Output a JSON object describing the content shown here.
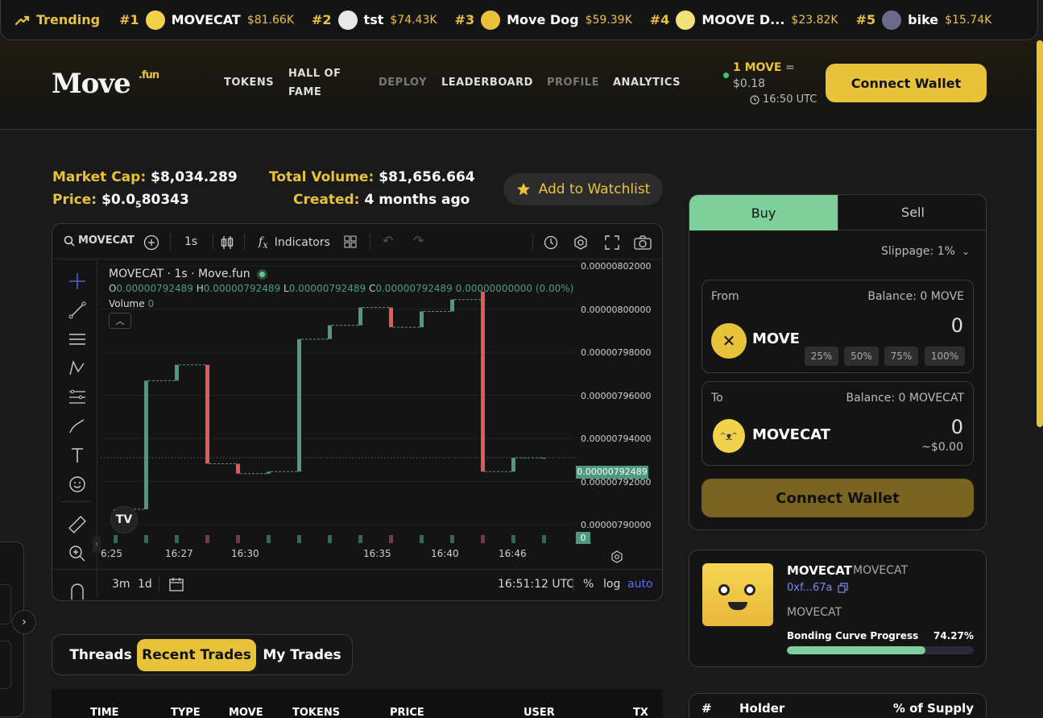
{
  "trending": {
    "label": "Trending",
    "items": [
      {
        "rank": "#1",
        "name": "MOVECAT",
        "value": "$81.66K",
        "avatar_color": "#f2d24b"
      },
      {
        "rank": "#2",
        "name": "tst",
        "value": "$74.43K",
        "avatar_color": "#e8e8e8"
      },
      {
        "rank": "#3",
        "name": "Move Dog",
        "value": "$59.39K",
        "avatar_color": "#e8c33a"
      },
      {
        "rank": "#4",
        "name": "MOOVE D...",
        "value": "$23.82K",
        "avatar_color": "#f2e27a"
      },
      {
        "rank": "#5",
        "name": "bike",
        "value": "$15.74K",
        "avatar_color": "#6a6a8a"
      }
    ]
  },
  "header": {
    "logo": "Move",
    "logo_suffix": ".fun",
    "nav": [
      "TOKENS",
      "HALL OF FAME",
      "DEPLOY",
      "LEADERBOARD",
      "PROFILE",
      "ANALYTICS"
    ],
    "rate_label": "1 MOVE",
    "rate_eq": "=",
    "rate_value": "$0.18",
    "time": "16:50 UTC",
    "connect": "Connect Wallet"
  },
  "stats": {
    "market_cap_label": "Market Cap:",
    "market_cap": "$8,034.289",
    "price_label": "Price:",
    "price_a": "$0.0",
    "price_sub": "5",
    "price_b": "80343",
    "volume_label": "Total Volume:",
    "volume": "$81,656.664",
    "created_label": "Created:",
    "created": "4 months ago",
    "watchlist": "Add to Watchlist"
  },
  "chart": {
    "symbol": "MOVECAT",
    "interval": "1s",
    "indicators": "Indicators",
    "title": "MOVECAT · 1s · Move.fun",
    "ohlc": {
      "o": "0.00000792489",
      "h": "0.00000792489",
      "l": "0.00000792489",
      "c": "0.00000792489",
      "chg": "0.00000000000 (0.00%)"
    },
    "volume_label": "Volume",
    "volume_value": "0",
    "last_price_tag": "0.00000792489",
    "volume_tag": "0",
    "bottom_ranges": [
      "3m",
      "1d"
    ],
    "clock": "16:51:12 UTC",
    "scale_opts": [
      "%",
      "log",
      "auto"
    ],
    "chart_data": {
      "type": "candlestick",
      "title": "MOVECAT · 1s · Move.fun",
      "ylim": [
        7.89e-06,
        8.022e-06
      ],
      "y_ticks": [
        "0.00000802000",
        "0.00000800000",
        "0.00000798000",
        "0.00000796000",
        "0.00000794000",
        "0.00000792000",
        "0.00000790000"
      ],
      "x_ticks": [
        "6:25",
        "16:27",
        "16:30",
        "16:35",
        "16:40",
        "16:46"
      ],
      "candles": [
        {
          "o": 7.893e-06,
          "c": 7.899e-06,
          "dir": "up"
        },
        {
          "o": 7.899e-06,
          "c": 7.964e-06,
          "dir": "up"
        },
        {
          "o": 7.964e-06,
          "c": 7.972e-06,
          "dir": "up"
        },
        {
          "o": 7.972e-06,
          "c": 7.922e-06,
          "dir": "down"
        },
        {
          "o": 7.922e-06,
          "c": 7.917e-06,
          "dir": "down"
        },
        {
          "o": 7.917e-06,
          "c": 7.918e-06,
          "dir": "up"
        },
        {
          "o": 7.918e-06,
          "c": 7.985e-06,
          "dir": "up"
        },
        {
          "o": 7.985e-06,
          "c": 7.992e-06,
          "dir": "up"
        },
        {
          "o": 7.992e-06,
          "c": 8.001e-06,
          "dir": "up"
        },
        {
          "o": 8.001e-06,
          "c": 7.991e-06,
          "dir": "down"
        },
        {
          "o": 7.991e-06,
          "c": 7.999e-06,
          "dir": "up"
        },
        {
          "o": 7.999e-06,
          "c": 8.005e-06,
          "dir": "up"
        },
        {
          "o": 8.009e-06,
          "c": 7.918e-06,
          "dir": "down"
        },
        {
          "o": 7.918e-06,
          "c": 7.925e-06,
          "dir": "up"
        },
        {
          "o": 7.925e-06,
          "c": 7.925e-06,
          "dir": "flat"
        }
      ]
    }
  },
  "tabs": [
    "Threads",
    "Recent Trades",
    "My Trades"
  ],
  "trades_columns": [
    "TIME",
    "TYPE",
    "MOVE",
    "TOKENS",
    "PRICE",
    "USER",
    "TX"
  ],
  "swap": {
    "buy": "Buy",
    "sell": "Sell",
    "slippage": "Slippage: 1%",
    "from_label": "From",
    "from_balance": "Balance: 0 MOVE",
    "from_token": "MOVE",
    "from_amount": "0",
    "pct": [
      "25%",
      "50%",
      "75%",
      "100%"
    ],
    "to_label": "To",
    "to_balance": "Balance: 0 MOVECAT",
    "to_token": "MOVECAT",
    "to_amount": "0",
    "to_usd": "~$0.00",
    "connect": "Connect Wallet"
  },
  "token_info": {
    "name": "MOVECAT",
    "ticker": "MOVECAT",
    "address": "0xf...67a",
    "description": "MOVECAT",
    "progress_label": "Bonding Curve Progress",
    "progress_value": "74.27%",
    "progress_fraction": 0.7427
  },
  "holders": {
    "columns": [
      "#",
      "Holder",
      "% of Supply"
    ]
  },
  "colors": {
    "accent": "#e8c33a",
    "up": "#4f9a7e",
    "down": "#e05a5a",
    "buy_tab": "#7fcf9a",
    "progress": "#7fcf9a"
  }
}
